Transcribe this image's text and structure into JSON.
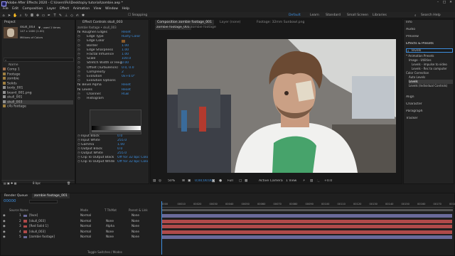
{
  "app": {
    "title": "Adobe After Effects 2020 - C:\\Users\\Fki\\Desktop\\y tutorial\\zombie.aep *"
  },
  "menu": [
    "File",
    "Edit",
    "Composition",
    "Layer",
    "Effect",
    "Animation",
    "View",
    "Window",
    "Help"
  ],
  "toolbar": {
    "snapping": "Snapping",
    "workspaces": [
      "Default",
      "Learn",
      "Standard",
      "Small Screen",
      "Libraries"
    ],
    "search_placeholder": "Search Help"
  },
  "project": {
    "tab": "Project",
    "item_name": "skull_003",
    "item_info1": "▼ , used 1 times",
    "item_info2": "147 x 1400 (1.00)",
    "item_info3": "Millions of Colors",
    "search_placeholder": "",
    "name_header": "Name",
    "items": [
      {
        "name": "Comp 1",
        "color": "#a07050",
        "type": "comp"
      },
      {
        "name": "Footage",
        "color": "#a08040",
        "type": "folder"
      },
      {
        "name": "zombie",
        "color": "#a08040",
        "type": "folder"
      },
      {
        "name": "Solids",
        "color": "#a08040",
        "type": "folder"
      },
      {
        "name": "body_001",
        "color": "#909090",
        "type": "file"
      },
      {
        "name": "beard_001.png",
        "color": "#909090",
        "type": "file"
      },
      {
        "name": "skull_001",
        "color": "#909090",
        "type": "file"
      },
      {
        "name": "skull_003",
        "color": "#909090",
        "type": "file",
        "selected": true
      },
      {
        "name": "c4s footage",
        "color": "#a08040",
        "type": "folder"
      }
    ],
    "footer": "8 bpc"
  },
  "effects": {
    "tab": "Effect Controls skull_003",
    "layer": "zombie footage • skull_003",
    "rows": [
      {
        "label": "Roughen Edges",
        "value": "Reset",
        "fx": true
      },
      {
        "label": "Edge Type",
        "value": "Rusty Color"
      },
      {
        "label": "Edge Color",
        "value": "",
        "swatch": "#8a5a2a"
      },
      {
        "label": "Border",
        "value": "1.00"
      },
      {
        "label": "Edge Sharpness",
        "value": "1.00"
      },
      {
        "label": "Fractal Influence",
        "value": "1.00"
      },
      {
        "label": "Scale",
        "value": "100.0"
      },
      {
        "label": "Stretch Width or Heig",
        "value": "0.00"
      },
      {
        "label": "Offset (Turbulence)",
        "value": "0.0, 0.0"
      },
      {
        "label": "Complexity",
        "value": "2"
      },
      {
        "label": "Evolution",
        "value": "0x+0.0°"
      },
      {
        "label": "Evolution Options",
        "value": ""
      },
      {
        "label": "Bevel Alpha",
        "value": "Reset",
        "fx": true
      },
      {
        "label": "Levels",
        "value": "Reset",
        "fx": true
      },
      {
        "label": "Channel:",
        "value": "RGB"
      },
      {
        "label": "Histogram",
        "value": ""
      }
    ],
    "levels_rows": [
      {
        "label": "Input Black",
        "value": "0.0"
      },
      {
        "label": "Input White",
        "value": "255.0"
      },
      {
        "label": "Gamma",
        "value": "1.00"
      },
      {
        "label": "Output Black",
        "value": "0.0"
      },
      {
        "label": "Output White",
        "value": "255.0"
      },
      {
        "label": "Clip To Output Black",
        "value": "Off for 32 bpc Colo"
      },
      {
        "label": "Clip To Output White",
        "value": "Off for 32 bpc Colo"
      }
    ]
  },
  "comp": {
    "tab": "Composition zombie footage_001",
    "extra_tabs": [
      "Layer (none)",
      "Footage: 32mm Sunbowl.png"
    ],
    "subtabs": [
      "zombie footage_001",
      "zombie footage"
    ],
    "zoom": "50%",
    "timecode": "0;00;00;00",
    "resolution": "Full",
    "camera": "Active Camera",
    "views": "1 View",
    "exposure": "+0.0"
  },
  "right": {
    "items": [
      "Info",
      "Audio",
      "Preview",
      "Effects & Presets"
    ],
    "search_value": "levels",
    "tree": [
      {
        "label": "* Animation Presets",
        "indent": 0
      },
      {
        "label": "Image - Utilities",
        "indent": 1
      },
      {
        "label": "Levels - impulse to video",
        "indent": 2
      },
      {
        "label": "Levels - Rec to computer",
        "indent": 2
      },
      {
        "label": "Color Correction",
        "indent": 0
      },
      {
        "label": "Auto Levels",
        "indent": 1
      },
      {
        "label": "Levels",
        "indent": 1,
        "selected": true
      },
      {
        "label": "Levels (Individual Controls)",
        "indent": 1
      }
    ],
    "bottom_items": [
      "Align",
      "Character",
      "Paragraph",
      "Tracker"
    ]
  },
  "timeline": {
    "tabs": [
      "Render Queue",
      "zombie footage_001"
    ],
    "timecode": "00000",
    "cols": [
      "Source Name",
      "Mode",
      "T TrkMat",
      "Parent & Link"
    ],
    "layers": [
      {
        "num": "1",
        "name": "[face]",
        "color": "#6a6a9a",
        "mode": "Normal",
        "trk": "",
        "parent": "None"
      },
      {
        "num": "2",
        "name": "[skull_003]",
        "color": "#b04a4a",
        "mode": "Normal",
        "trk": "None",
        "parent": "None"
      },
      {
        "num": "3",
        "name": "[Red Solid 1]",
        "color": "#b04a4a",
        "mode": "Normal",
        "trk": "Alpha",
        "parent": "None"
      },
      {
        "num": "4",
        "name": "[skull_003]",
        "color": "#b04a4a",
        "mode": "Normal",
        "trk": "None",
        "parent": "None"
      },
      {
        "num": "5",
        "name": "[zombie footage]",
        "color": "#6a6a9a",
        "mode": "Normal",
        "trk": "None",
        "parent": "None"
      }
    ],
    "ruler": [
      "0000",
      "00010",
      "00020",
      "00030",
      "00040",
      "00050",
      "00060",
      "00070",
      "00080",
      "00090",
      "00100",
      "00110",
      "00120",
      "00130",
      "00140",
      "00150",
      "00160",
      "00170",
      "00180"
    ],
    "footer": "Toggle Switches / Modes"
  },
  "colors": {
    "accent": "#3d8fe0",
    "panel": "#232323",
    "bg": "#1d1d1d"
  }
}
